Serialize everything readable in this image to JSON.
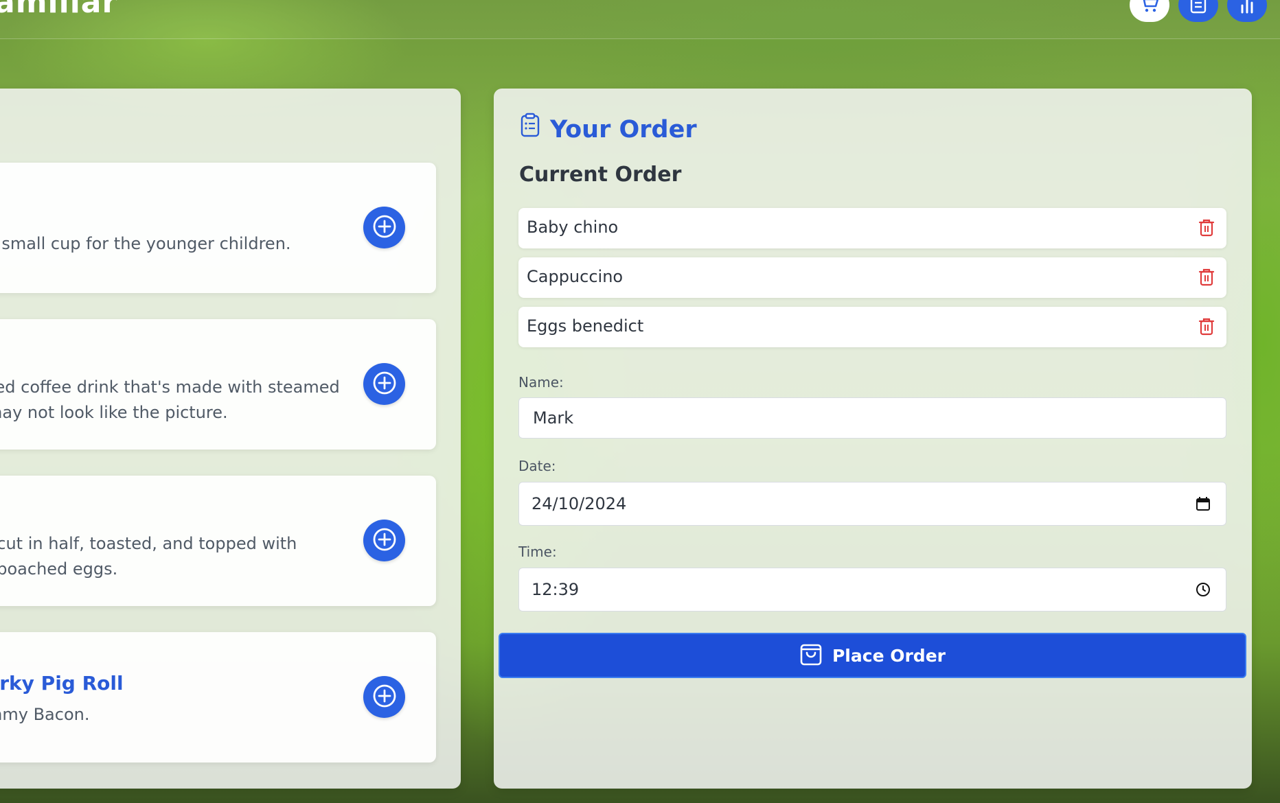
{
  "header": {
    "brand": "amiliar",
    "nav": {
      "cart_icon": "cart-icon",
      "orders_icon": "clipboard-list-icon",
      "stats_icon": "bar-chart-icon"
    }
  },
  "menu": {
    "items": [
      {
        "title": "",
        "description": "a small cup for the younger children."
      },
      {
        "title": "",
        "description": "sed coffee drink that's made with steamed\n may not look like the picture."
      },
      {
        "title": "",
        "description": ", cut in half, toasted, and topped with\n, poached eggs."
      },
      {
        "title": "orky Pig Roll",
        "description": "mmy Bacon."
      }
    ],
    "add_icon": "plus-circle-icon",
    "colors": {
      "accent": "#2b62e3"
    }
  },
  "order": {
    "title": "Your Order",
    "title_icon": "clipboard-icon",
    "current_heading": "Current Order",
    "items": [
      {
        "name": "Baby chino"
      },
      {
        "name": "Cappuccino"
      },
      {
        "name": "Eggs benedict"
      }
    ],
    "delete_icon": "trash-icon",
    "fields": {
      "name_label": "Name:",
      "name_value": "Mark",
      "date_label": "Date:",
      "date_value": "24/10/2024",
      "time_label": "Time:",
      "time_value": "12:39"
    },
    "place_button": "Place Order",
    "colors": {
      "delete": "#e03b3b",
      "button": "#1d4ed8"
    }
  }
}
